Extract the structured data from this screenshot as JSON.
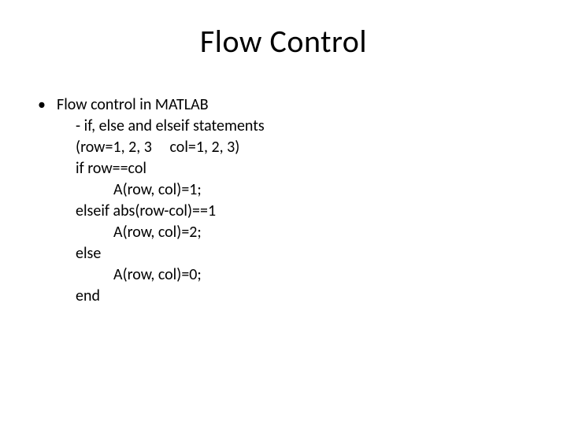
{
  "title": "Flow Control",
  "bullet1": "Flow control in MATLAB",
  "lines": {
    "l1": "- if, else and elseif statements",
    "l2": "(row=1, 2, 3     col=1, 2, 3)",
    "l3": "if row==col",
    "l4": "A(row, col)=1;",
    "l5": "elseif abs(row-col)==1",
    "l6": "A(row, col)=2;",
    "l7": "else",
    "l8": "A(row, col)=0;",
    "l9": "end"
  }
}
